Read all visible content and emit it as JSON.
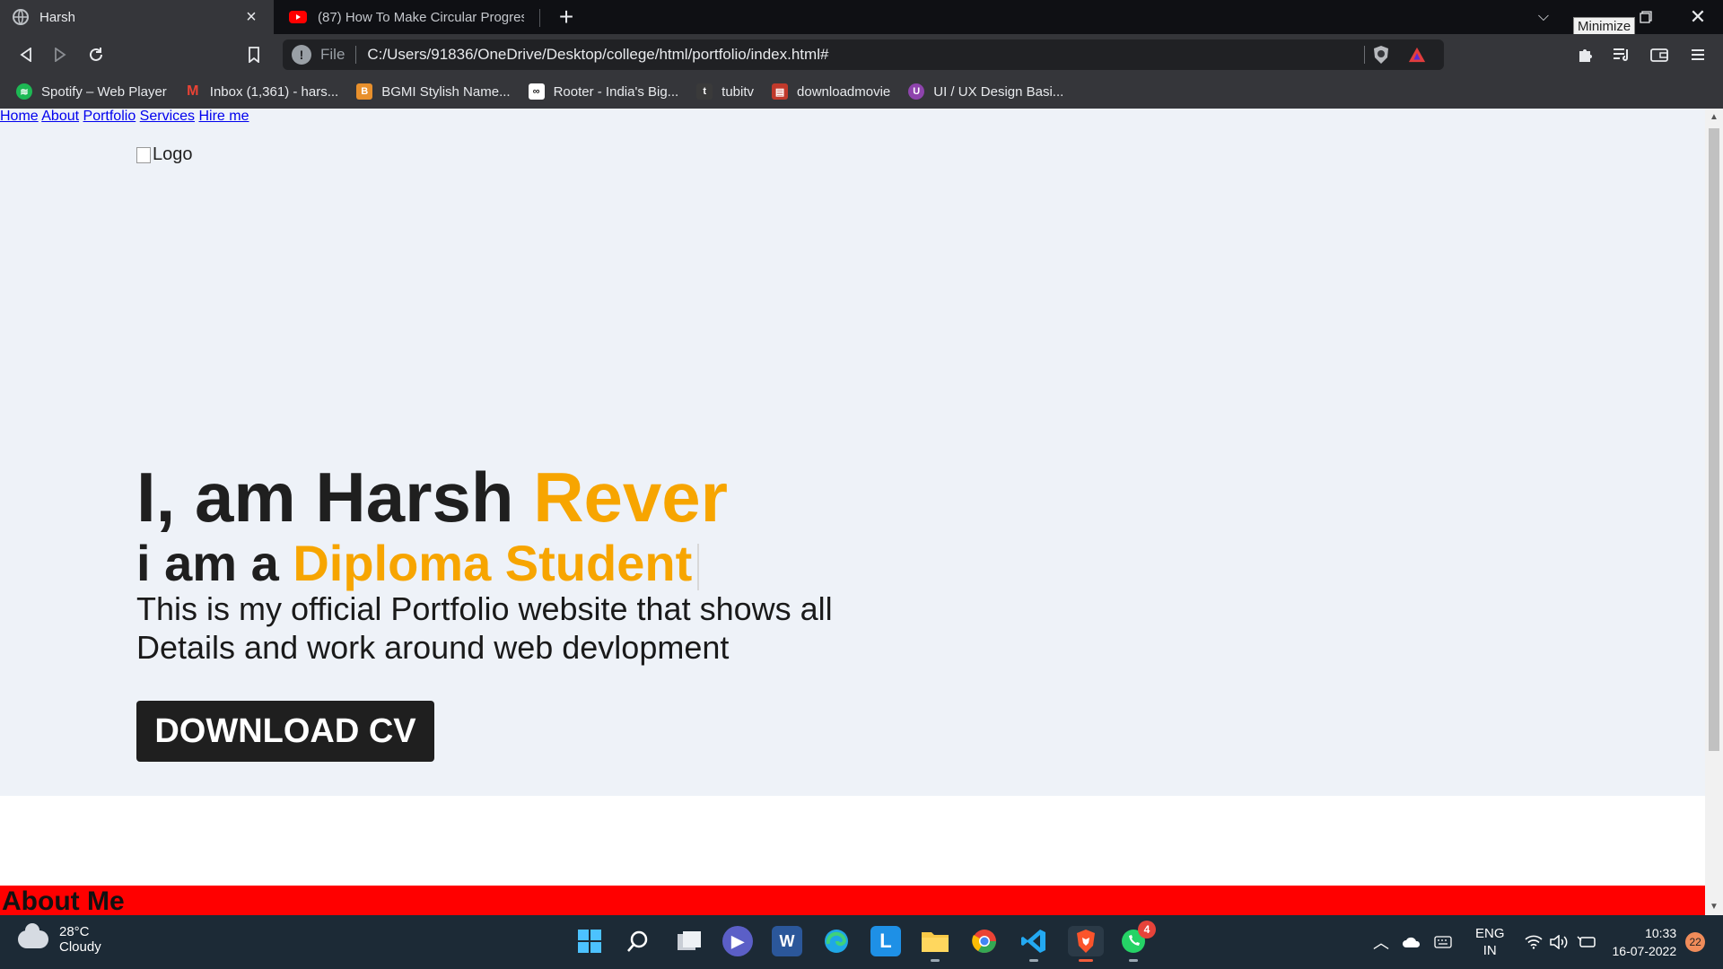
{
  "browser": {
    "tabs": [
      {
        "title": "Harsh",
        "active": true
      },
      {
        "title": "(87) How To Make Circular Progress Ba",
        "active": false
      }
    ],
    "tooltip": "Minimize",
    "address": {
      "scheme_label": "File",
      "url": "C:/Users/91836/OneDrive/Desktop/college/html/portfolio/index.html#"
    },
    "bookmarks": [
      {
        "label": "Spotify – Web Player",
        "icon": "spotify-icon",
        "color": "#1db954"
      },
      {
        "label": "Inbox (1,361) - hars...",
        "icon": "gmail-icon",
        "color": "#ea4335"
      },
      {
        "label": "BGMI Stylish Name...",
        "icon": "bgmi-icon",
        "color": "#e8902c"
      },
      {
        "label": "Rooter - India's Big...",
        "icon": "rooter-icon",
        "color": "#ffffff"
      },
      {
        "label": "tubitv",
        "icon": "tubitv-icon",
        "color": "#3a3a3a"
      },
      {
        "label": "downloadmovie",
        "icon": "folder-icon",
        "color": "#c0392b"
      },
      {
        "label": "UI / UX Design Basi...",
        "icon": "uiux-icon",
        "color": "#8e44ad"
      }
    ]
  },
  "site": {
    "logo_alt": "Logo",
    "nav": [
      "Home",
      "About",
      "Portfolio",
      "Services",
      "Hire me"
    ],
    "hero": {
      "greeting": "I, am Harsh",
      "surname": "Rever",
      "role_prefix": "i am a",
      "role": "Diploma Student",
      "description": "This is my official Portfolio website that shows all Details and work around web devlopment",
      "cta": "DOWNLOAD CV"
    },
    "section_title": "About Me",
    "accent_color": "#f7a500",
    "section_color": "#ff0000"
  },
  "taskbar": {
    "weather": {
      "temp": "28°C",
      "condition": "Cloudy"
    },
    "lang": {
      "line1": "ENG",
      "line2": "IN"
    },
    "time": "10:33",
    "date": "16-07-2022",
    "notifications": "22",
    "whatsapp_badge": "4"
  }
}
